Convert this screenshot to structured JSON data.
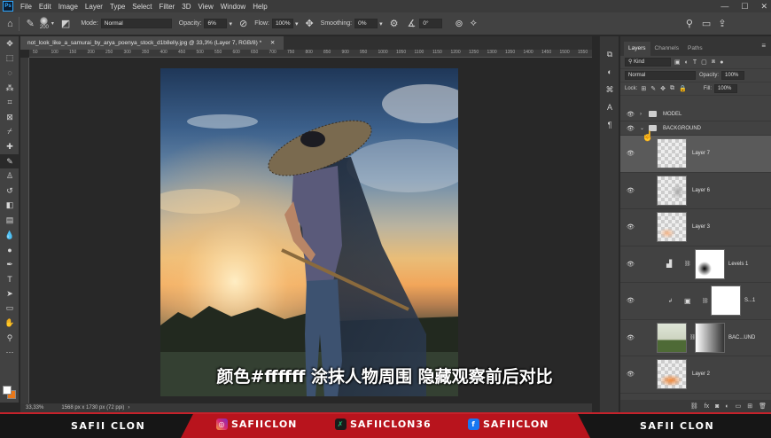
{
  "app": {
    "logo": "Ps"
  },
  "menu": [
    "File",
    "Edit",
    "Image",
    "Layer",
    "Type",
    "Select",
    "Filter",
    "3D",
    "View",
    "Window",
    "Help"
  ],
  "window_controls": [
    "—",
    "☐",
    "✕"
  ],
  "options": {
    "brush_size": "200",
    "mode_label": "Mode:",
    "mode_value": "Normal",
    "opacity_label": "Opacity:",
    "opacity_value": "6%",
    "flow_label": "Flow:",
    "flow_value": "100%",
    "smoothing_label": "Smoothing:",
    "smoothing_value": "0%",
    "angle_value": "0°"
  },
  "document": {
    "tab_title": "not_look_like_a_samurai_by_arya_poenya_stock_d1b8elly.jpg @ 33,3% (Layer 7, RGB/8) *",
    "zoom": "33,33%",
    "doc_info": "1568 px x 1730 px (72 ppi)",
    "ruler_ticks": [
      "50",
      "100",
      "150",
      "200",
      "250",
      "300",
      "350",
      "400",
      "450",
      "500",
      "550",
      "600",
      "650",
      "700",
      "750",
      "800",
      "850",
      "900",
      "950",
      "1000",
      "1050",
      "1100",
      "1150",
      "1200",
      "1250",
      "1300",
      "1350",
      "1400",
      "1450",
      "1500",
      "1550"
    ]
  },
  "subtitle": "颜色#ffffff 涂抹人物周围 隐藏观察前后对比",
  "panel": {
    "tabs": [
      "Layers",
      "Channels",
      "Paths"
    ],
    "filter_kind": "Kind",
    "blend_mode": "Normal",
    "opacity_label": "Opacity:",
    "opacity_value": "100%",
    "lock_label": "Lock:",
    "fill_label": "Fill:",
    "fill_value": "100%",
    "layers": [
      {
        "name": "MODEL",
        "type": "group"
      },
      {
        "name": "BACKGROUND",
        "type": "group"
      },
      {
        "name": "Layer 7",
        "type": "layer"
      },
      {
        "name": "Layer 6",
        "type": "layer"
      },
      {
        "name": "Layer 3",
        "type": "layer"
      },
      {
        "name": "Levels 1",
        "type": "adjustment"
      },
      {
        "name": "S...1",
        "type": "adjustment"
      },
      {
        "name": "BAC...UND",
        "type": "layer"
      },
      {
        "name": "Layer 2",
        "type": "layer"
      }
    ]
  },
  "banner": {
    "left_name": "SAFII CLON",
    "instagram": "SAFIICLON",
    "fiverr": "SAFIICLON36",
    "facebook": "SAFIICLON",
    "right_name": "SAFII CLON"
  },
  "colors": {
    "foreground": "#ffffff",
    "background": "#e8781a",
    "banner_red": "#b8141d"
  }
}
